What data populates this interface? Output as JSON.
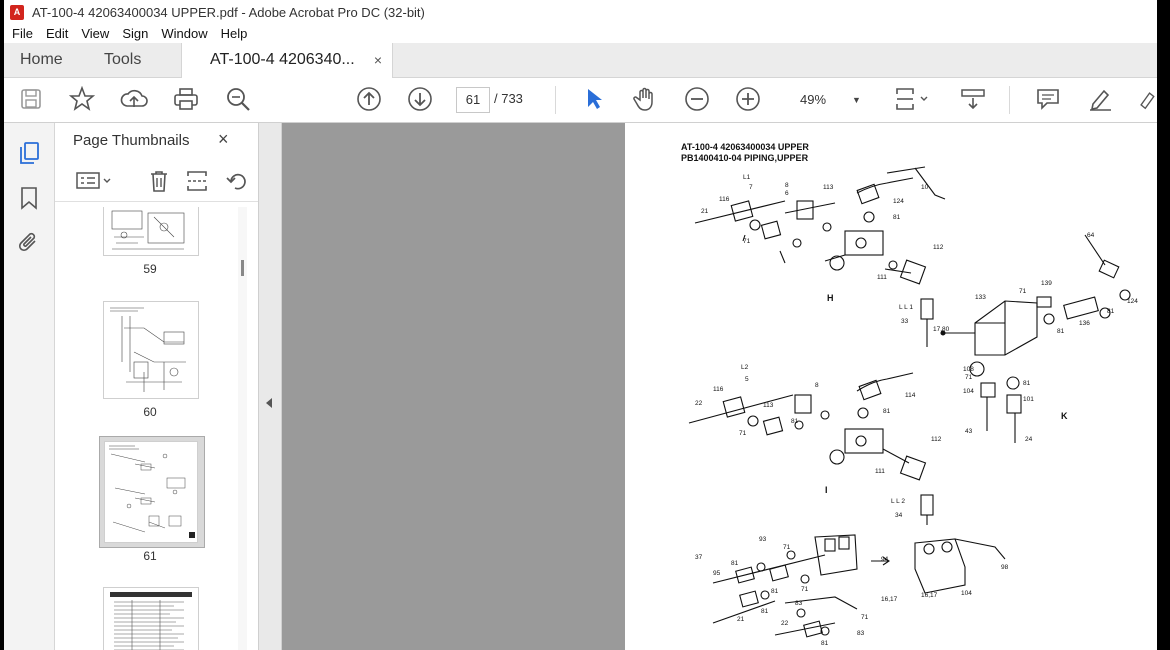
{
  "window": {
    "title": "AT-100-4 42063400034 UPPER.pdf - Adobe Acrobat Pro DC (32-bit)"
  },
  "menu": [
    "File",
    "Edit",
    "View",
    "Sign",
    "Window",
    "Help"
  ],
  "tabs": {
    "home": "Home",
    "tools": "Tools",
    "document": "AT-100-4 4206340...",
    "close": "×"
  },
  "toolbar": {
    "current_page": "61",
    "total_pages": "/ 733",
    "zoom": "49%"
  },
  "panel": {
    "title": "Page Thumbnails",
    "close": "×"
  },
  "thumbnails": [
    {
      "label": "59"
    },
    {
      "label": "60"
    },
    {
      "label": "61"
    }
  ],
  "document_page": {
    "header_line1": "AT-100-4 42063400034 UPPER",
    "header_line2": "PB1400410-04 PIPING,UPPER",
    "section_labels": [
      "H",
      "K",
      "I"
    ],
    "callouts": [
      "L1",
      "7",
      "8",
      "6",
      "113",
      "116",
      "21",
      "71",
      "114",
      "124",
      "10",
      "81",
      "112",
      "111",
      "64",
      "139",
      "71",
      "81",
      "L L 1",
      "33",
      "133",
      "17,80",
      "124",
      "81",
      "136",
      "L2",
      "5",
      "8",
      "113",
      "116",
      "22",
      "81",
      "71",
      "114",
      "81",
      "112",
      "111",
      "108",
      "71",
      "104",
      "101",
      "81",
      "43",
      "K",
      "24",
      "L L 2",
      "34",
      "I",
      "93",
      "37",
      "95",
      "81",
      "71",
      "94",
      "98",
      "81",
      "83",
      "71",
      "16,17",
      "16,17",
      "104",
      "21",
      "81",
      "22",
      "71",
      "83",
      "81"
    ]
  },
  "colors": {
    "accent": "#2a6ed8",
    "logo": "#d2251d",
    "gutter": "#9a9a9a"
  }
}
